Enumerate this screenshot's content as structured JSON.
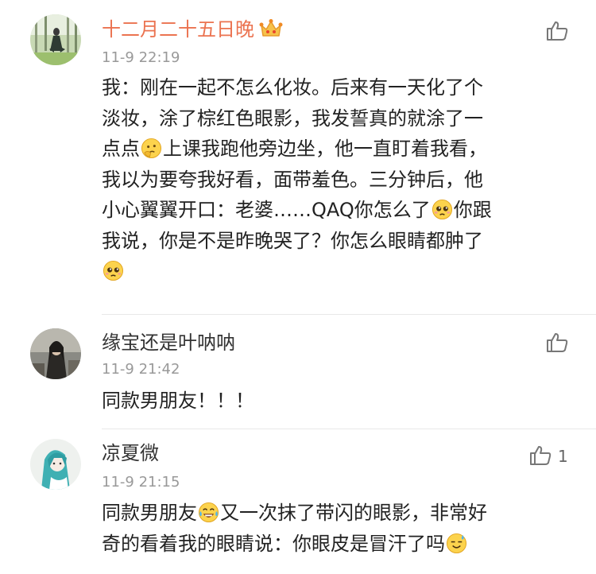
{
  "comments": [
    {
      "username": "十二月二十五日晚",
      "time": "11-9 22:19",
      "lines": [
        {
          "segments": [
            {
              "text": "我：刚在一起不怎么化妆。后来有一天化了个"
            }
          ]
        },
        {
          "segments": [
            {
              "text": "淡妆，涂了棕红色眼影，我发誓真的就涂了一"
            }
          ]
        },
        {
          "segments": [
            {
              "text": "点点"
            },
            {
              "emoji": "thinking-emoji"
            },
            {
              "text": "上课我跑他旁边坐，他一直盯着我看，"
            }
          ]
        },
        {
          "segments": [
            {
              "text": "我以为要夸我好看，面带羞色。三分钟后，他"
            }
          ]
        },
        {
          "segments": [
            {
              "text": "小心翼翼开口：老婆……QAQ你怎么了"
            },
            {
              "emoji": "pleading-emoji"
            },
            {
              "text": "你跟"
            }
          ]
        },
        {
          "segments": [
            {
              "text": "我说，你是不是昨晚哭了？你怎么眼睛都肿了"
            }
          ]
        },
        {
          "segments": [
            {
              "emoji": "pleading-emoji"
            }
          ]
        }
      ]
    },
    {
      "username": "缘宝还是叶呐呐",
      "time": "11-9 21:42",
      "lines": [
        {
          "segments": [
            {
              "text": "同款男朋友！！！"
            }
          ]
        }
      ]
    },
    {
      "username": "凉夏微",
      "time": "11-9 21:15",
      "like_count": "1",
      "lines": [
        {
          "segments": [
            {
              "text": "同款男朋友"
            },
            {
              "emoji": "laughing-tears-emoji"
            },
            {
              "text": "又一次抹了带闪的眼影，非常好"
            }
          ]
        },
        {
          "segments": [
            {
              "text": "奇的看着我的眼睛说：你眼皮是冒汗了吗"
            },
            {
              "emoji": "sweat-smile-emoji"
            }
          ]
        }
      ]
    }
  ]
}
